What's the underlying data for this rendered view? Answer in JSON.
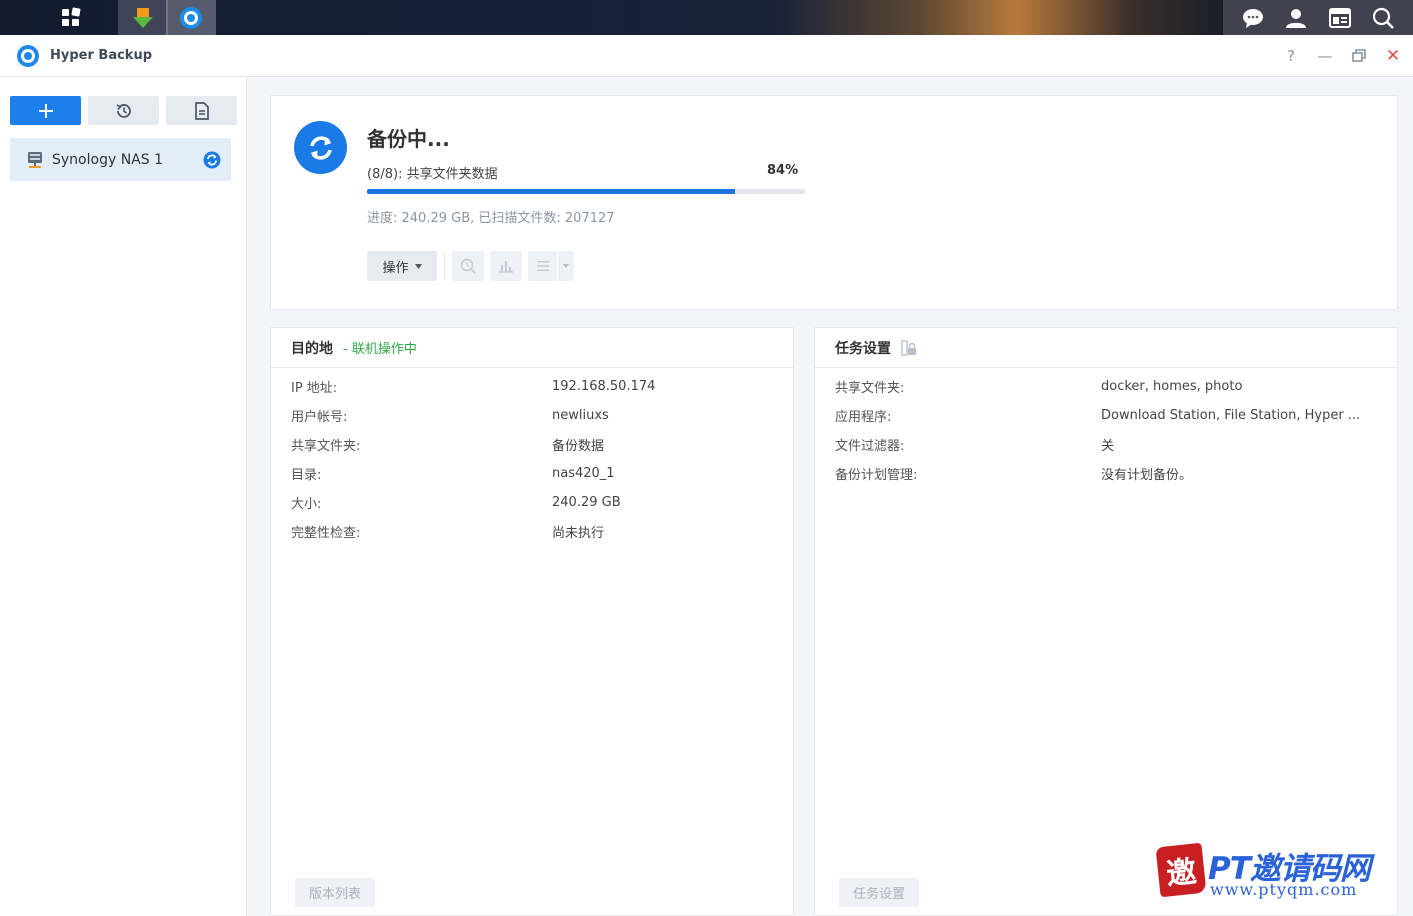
{
  "app": {
    "title": "Hyper Backup"
  },
  "window_controls": {
    "help": "?",
    "minimize": "—",
    "restore": "▭",
    "close": "✕"
  },
  "sidebar": {
    "tools": {
      "add": "+",
      "restore": "restore-icon",
      "log": "log-icon"
    },
    "items": [
      {
        "label": "Synology NAS 1",
        "status": "syncing"
      }
    ]
  },
  "status": {
    "title": "备份中...",
    "step": "(8/8): 共享文件夹数据",
    "percent_label": "84%",
    "progress": 0.84,
    "info": "进度: 240.29 GB, 已扫描文件数: 207127",
    "action_label": "操作"
  },
  "destination": {
    "title": "目的地",
    "subtitle": "- 联机操作中",
    "rows": [
      {
        "k": "IP 地址:",
        "v": "192.168.50.174"
      },
      {
        "k": "用户帐号:",
        "v": "newliuxs"
      },
      {
        "k": "共享文件夹:",
        "v": "备份数据"
      },
      {
        "k": "目录:",
        "v": "nas420_1"
      },
      {
        "k": "大小:",
        "v": "240.29 GB"
      },
      {
        "k": "完整性检查:",
        "v": "尚未执行"
      }
    ],
    "footer_button": "版本列表"
  },
  "task": {
    "title": "任务设置",
    "rows": [
      {
        "k": "共享文件夹:",
        "v": "docker, homes, photo"
      },
      {
        "k": "应用程序:",
        "v": "Download Station, File Station, Hyper ..."
      },
      {
        "k": "文件过滤器:",
        "v": "关"
      },
      {
        "k": "备份计划管理:",
        "v": "没有计划备份。"
      }
    ],
    "footer_button": "任务设置"
  },
  "watermark": {
    "seal": "邀",
    "text": "PT邀请码网",
    "url": "www.ptyqm.com"
  },
  "colors": {
    "accent": "#1d7fea",
    "online": "#2ea84a",
    "close": "#e14b4b"
  }
}
